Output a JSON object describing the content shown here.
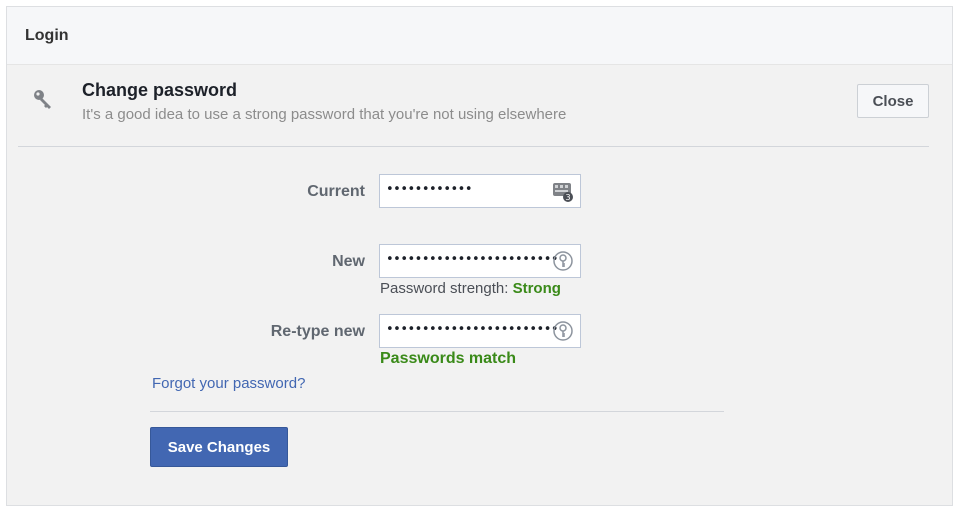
{
  "panel": {
    "title": "Login"
  },
  "section": {
    "title": "Change password",
    "subtitle": "It's a good idea to use a strong password that you're not using elsewhere",
    "close_label": "Close",
    "icon": "key-icon"
  },
  "form": {
    "current": {
      "label": "Current",
      "value": "••••••••••••",
      "icon": "password-manager-icon"
    },
    "new": {
      "label": "New",
      "value": "••••••••••••••••••••••••",
      "icon": "password-key-icon"
    },
    "strength": {
      "label": "Password strength:",
      "value": "Strong"
    },
    "retype": {
      "label": "Re-type new",
      "value": "••••••••••••••••••••••••",
      "icon": "password-key-icon"
    },
    "match_message": "Passwords match",
    "forgot_link": "Forgot your password?",
    "save_label": "Save Changes"
  },
  "colors": {
    "brand_blue": "#4267b2",
    "success_green": "#3a8a19",
    "link_blue": "#4267b2"
  }
}
